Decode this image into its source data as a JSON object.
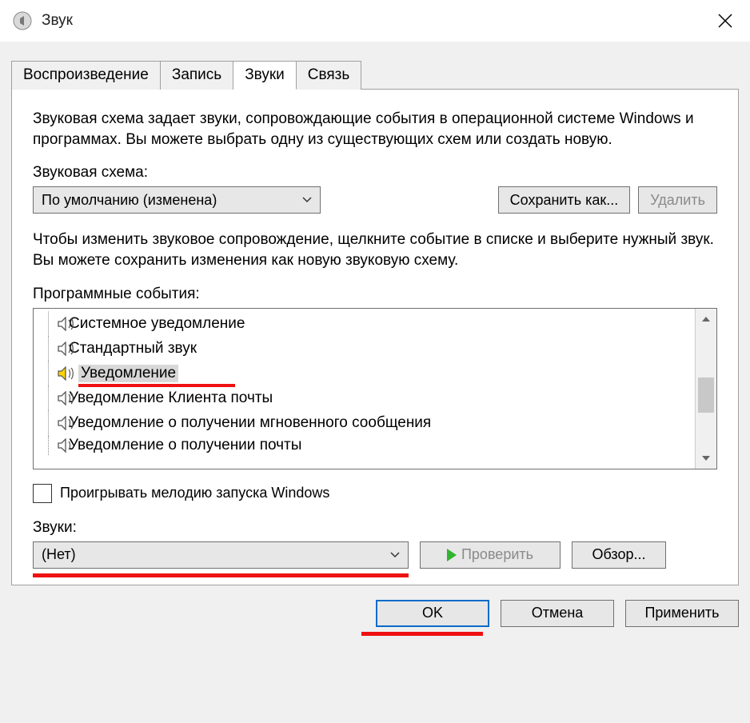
{
  "window": {
    "title": "Звук"
  },
  "tabs": [
    {
      "label": "Воспроизведение"
    },
    {
      "label": "Запись"
    },
    {
      "label": "Звуки"
    },
    {
      "label": "Связь"
    }
  ],
  "description": "Звуковая схема задает звуки, сопровождающие события в операционной системе Windows и программах. Вы можете выбрать одну из существующих схем или создать новую.",
  "scheme": {
    "label": "Звуковая схема:",
    "value": "По умолчанию (изменена)",
    "save_as": "Сохранить как...",
    "delete": "Удалить"
  },
  "events_help": "Чтобы изменить звуковое сопровождение, щелкните событие в списке и выберите нужный звук. Вы можете сохранить изменения как новую звуковую схему.",
  "events_label": "Программные события:",
  "events": [
    {
      "label": "Системное уведомление"
    },
    {
      "label": "Стандартный звук"
    },
    {
      "label": "Уведомление"
    },
    {
      "label": "Уведомление Клиента почты"
    },
    {
      "label": "Уведомление о получении мгновенного сообщения"
    },
    {
      "label": "Уведомление о получении почты"
    }
  ],
  "startup": {
    "label": "Проигрывать мелодию запуска Windows"
  },
  "sounds": {
    "label": "Звуки:",
    "value": "(Нет)",
    "test": "Проверить",
    "browse": "Обзор..."
  },
  "footer": {
    "ok": "OK",
    "cancel": "Отмена",
    "apply": "Применить"
  }
}
